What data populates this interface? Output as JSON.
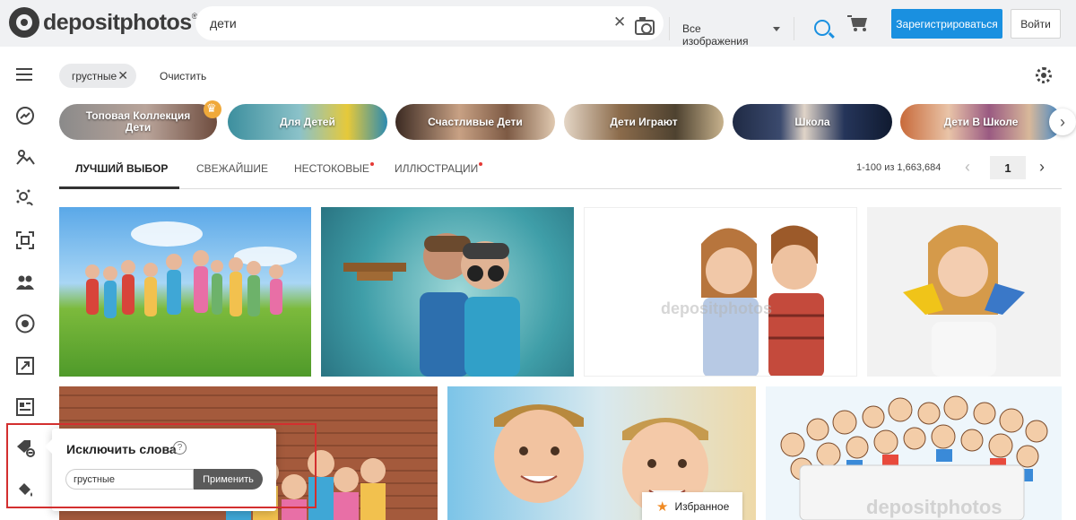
{
  "header": {
    "logo_text": "depositphotos",
    "logo_mark": "®",
    "search_value": "дети",
    "image_type": "Все изображения",
    "register_label": "Зарегистрироваться",
    "login_label": "Войти",
    "icons": [
      "camera-icon",
      "search-icon",
      "cart-icon",
      "clear-icon"
    ]
  },
  "filters": {
    "chip_label": "грустные",
    "clear_label": "Очистить"
  },
  "categories": [
    {
      "label": "Топовая Коллекция\nДети",
      "color": "#b08a7a"
    },
    {
      "label": "Для Детей",
      "color": "#5aa1b8"
    },
    {
      "label": "Счастливые Дети",
      "color": "#8a6c58"
    },
    {
      "label": "Дети Играют",
      "color": "#7d6a4e"
    },
    {
      "label": "Школа",
      "color": "#4c5a78"
    },
    {
      "label": "Дети В Школе",
      "color": "#8e7a6e"
    }
  ],
  "tabs": [
    {
      "label": "ЛУЧШИЙ ВЫБОР",
      "active": true
    },
    {
      "label": "СВЕЖАЙШИЕ",
      "active": false
    },
    {
      "label": "НЕСТОКОВЫЕ",
      "active": false,
      "dot": true
    },
    {
      "label": "ИЛЛЮСТРАЦИИ",
      "active": false,
      "dot": true
    }
  ],
  "pagination": {
    "results": "1-100 из 1,663,684",
    "page": "1"
  },
  "exclude": {
    "title": "Исключить слова",
    "help": "?",
    "input_value": "грустные",
    "apply_label": "Применить"
  },
  "favorites_label": "Избранное",
  "watermark": "depositphotos",
  "colors": {
    "accent": "#1a90e0",
    "highlight": "#d32f2f",
    "star": "#f08a24"
  }
}
